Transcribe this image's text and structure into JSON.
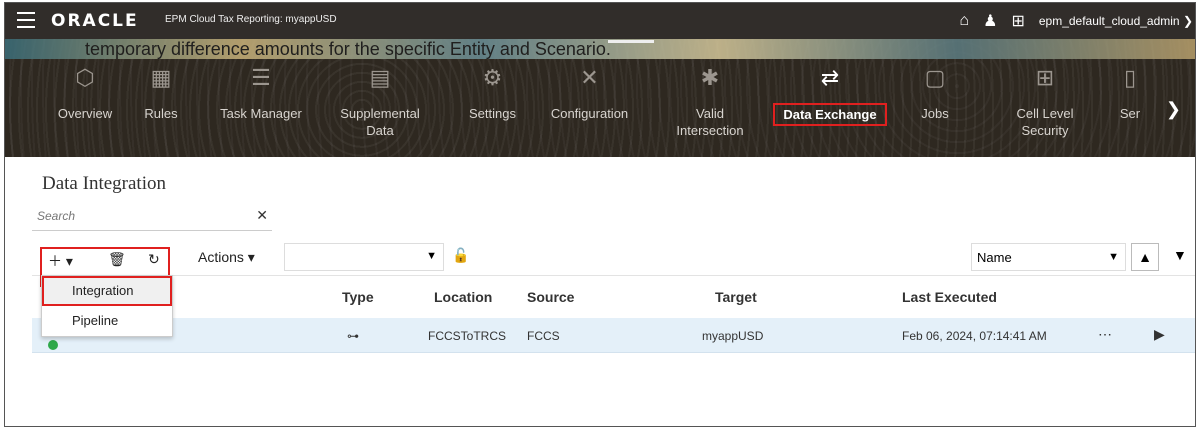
{
  "topbar": {
    "logo": "ORACLE",
    "app_title": "EPM Cloud Tax Reporting: myappUSD",
    "user": "epm_default_cloud_admin ❯"
  },
  "banner_text": "temporary difference amounts for the specific Entity and Scenario.",
  "nav": [
    {
      "label": "Overview",
      "icon": "cube-icon"
    },
    {
      "label": "Rules",
      "icon": "calculator-icon"
    },
    {
      "label": "Task Manager",
      "icon": "checklist-icon"
    },
    {
      "label": "Supplemental Data",
      "icon": "table-icon"
    },
    {
      "label": "Settings",
      "icon": "gear-icon"
    },
    {
      "label": "Configuration",
      "icon": "tools-icon"
    },
    {
      "label": "Valid Intersection",
      "icon": "intersection-icon"
    },
    {
      "label": "Data Exchange",
      "icon": "exchange-icon",
      "active": true
    },
    {
      "label": "Jobs",
      "icon": "clipboard-icon"
    },
    {
      "label": "Cell Level Security",
      "icon": "grid-lock-icon"
    },
    {
      "label": "Ser",
      "icon": "doc-icon"
    }
  ],
  "page": {
    "title": "Data Integration",
    "search_placeholder": "Search"
  },
  "toolbar": {
    "actions_label": "Actions",
    "sort_label": "Name"
  },
  "add_menu": [
    "Integration",
    "Pipeline"
  ],
  "columns": {
    "type": "Type",
    "location": "Location",
    "source": "Source",
    "target": "Target",
    "last_executed": "Last Executed"
  },
  "rows": [
    {
      "type": "⊶",
      "location": "FCCSToTRCS",
      "source": "FCCS",
      "target": "myappUSD",
      "last_executed": "Feb 06, 2024, 07:14:41 AM"
    }
  ]
}
